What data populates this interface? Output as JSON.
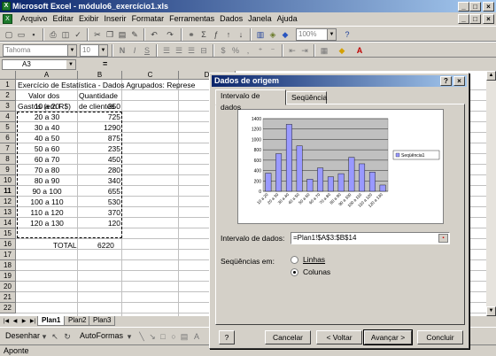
{
  "window": {
    "title": "Microsoft Excel - módulo6_exercício1.xls",
    "controls": [
      "_",
      "□",
      "×"
    ]
  },
  "menu": {
    "items": [
      "Arquivo",
      "Editar",
      "Exibir",
      "Inserir",
      "Formatar",
      "Ferramentas",
      "Dados",
      "Janela",
      "Ajuda"
    ],
    "doc_controls": [
      "_",
      "□",
      "×"
    ]
  },
  "toolbar": {
    "zoom": "100%",
    "font_name": "Tahoma",
    "font_size": "10"
  },
  "formula_bar": {
    "name_box": "A3",
    "equals": "="
  },
  "sheet": {
    "columns": [
      "A",
      "B",
      "C",
      "D"
    ],
    "rows": [
      "1",
      "2",
      "3",
      "4",
      "5",
      "6",
      "7",
      "8",
      "9",
      "10",
      "11",
      "12",
      "13",
      "14",
      "15",
      "16",
      "17",
      "18",
      "19",
      "20",
      "21",
      "22"
    ],
    "title": "Exercício de Estatística - Dados Agrupados: Represe",
    "header_a1": "Valor dos",
    "header_a2": "Gastos (em R$)",
    "header_b1": "Quantidade",
    "header_b2": "de clientes",
    "data": [
      {
        "range": "10 a 20",
        "count": "350"
      },
      {
        "range": "20 a 30",
        "count": "725"
      },
      {
        "range": "30 a 40",
        "count": "1290"
      },
      {
        "range": "40 a 50",
        "count": "875"
      },
      {
        "range": "50 a 60",
        "count": "235"
      },
      {
        "range": "60 a 70",
        "count": "450"
      },
      {
        "range": "70 a 80",
        "count": "280"
      },
      {
        "range": "80 a 90",
        "count": "340"
      },
      {
        "range": "90 a 100",
        "count": "655"
      },
      {
        "range": "100 a 110",
        "count": "530"
      },
      {
        "range": "110 a 120",
        "count": "370"
      },
      {
        "range": "120 a 130",
        "count": "120"
      }
    ],
    "total_label": "TOTAL",
    "total_value": "6220",
    "tabs": [
      "Plan1",
      "Plan2",
      "Plan3"
    ]
  },
  "drawing_toolbar": {
    "draw": "Desenhar",
    "autoshapes": "AutoFormas"
  },
  "status": "Aponte",
  "dialog": {
    "title": "Dados de origem",
    "title_buttons": [
      "?",
      "×"
    ],
    "tabs": [
      "Intervalo de dados",
      "Seqüência"
    ],
    "range_label": "Intervalo de dados:",
    "range_value": "=Plan1!$A$3:$B$14",
    "series_in_label": "Seqüências em:",
    "option_rows": "Linhas",
    "option_columns": "Colunas",
    "help": "?",
    "buttons": {
      "cancel": "Cancelar",
      "back": "< Voltar",
      "next": "Avançar >",
      "finish": "Concluir"
    }
  },
  "chart_data": {
    "type": "bar",
    "categories": [
      "10 a 20",
      "20 a 30",
      "30 a 40",
      "40 a 50",
      "50 a 60",
      "60 a 70",
      "70 a 80",
      "80 a 90",
      "90 a 100",
      "100 a 110",
      "110 a 120",
      "120 a 130"
    ],
    "series": [
      {
        "name": "Seqüência1",
        "values": [
          350,
          725,
          1290,
          875,
          235,
          450,
          280,
          340,
          655,
          530,
          370,
          120
        ]
      }
    ],
    "yticks": [
      "0",
      "200",
      "400",
      "600",
      "800",
      "1000",
      "1200",
      "1400"
    ],
    "ylim": [
      0,
      1400
    ],
    "grid": true,
    "legend": "right",
    "bar_color": "#9999ff"
  }
}
